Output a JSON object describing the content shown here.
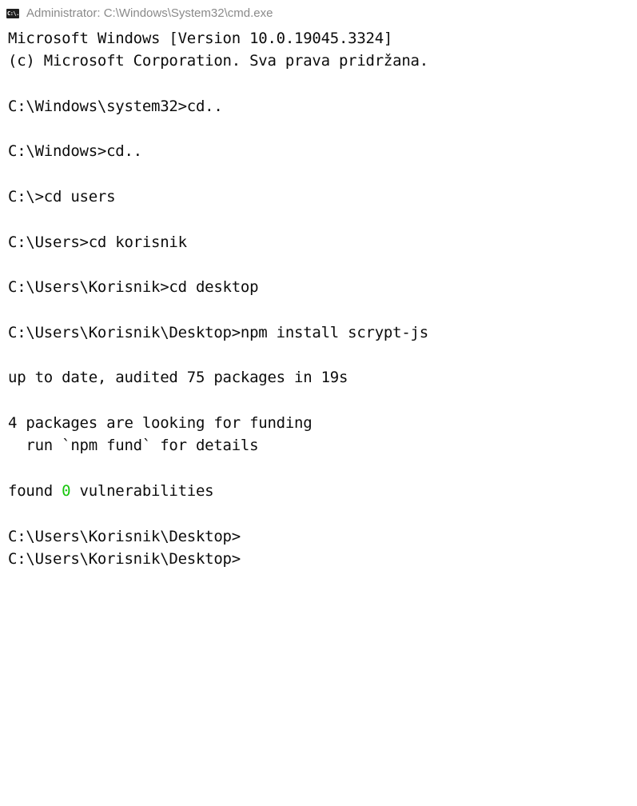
{
  "window": {
    "title": "Administrator: C:\\Windows\\System32\\cmd.exe",
    "icon": "cmd-icon",
    "icon_label": "C:\\."
  },
  "console": {
    "lines": [
      "Microsoft Windows [Version 10.0.19045.3324]",
      "(c) Microsoft Corporation. Sva prava pridržana.",
      "",
      "C:\\Windows\\system32>cd..",
      "",
      "C:\\Windows>cd..",
      "",
      "C:\\>cd users",
      "",
      "C:\\Users>cd korisnik",
      "",
      "C:\\Users\\Korisnik>cd desktop",
      "",
      "C:\\Users\\Korisnik\\Desktop>npm install scrypt-js",
      "",
      "up to date, audited 75 packages in 19s",
      "",
      "4 packages are looking for funding",
      "  run `npm fund` for details",
      "",
      {
        "segments": [
          {
            "text": "found "
          },
          {
            "text": "0",
            "color": "#16c60c"
          },
          {
            "text": " vulnerabilities"
          }
        ]
      },
      "",
      "C:\\Users\\Korisnik\\Desktop>",
      "C:\\Users\\Korisnik\\Desktop>"
    ]
  },
  "colors": {
    "background": "#ffffff",
    "text": "#0c0c0c",
    "title_text": "#8a8a8a",
    "highlight_number": "#16c60c"
  }
}
